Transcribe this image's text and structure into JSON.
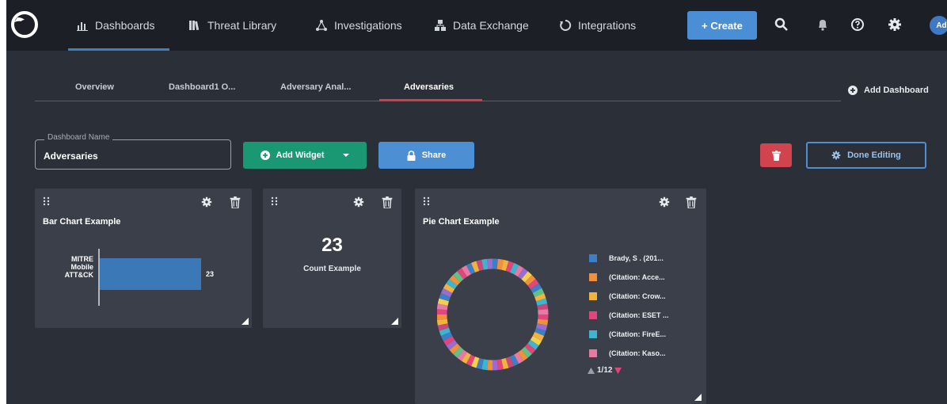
{
  "nav": {
    "items": [
      {
        "label": "Dashboards",
        "icon": "bar-chart-icon"
      },
      {
        "label": "Threat Library",
        "icon": "library-icon"
      },
      {
        "label": "Investigations",
        "icon": "network-icon"
      },
      {
        "label": "Data Exchange",
        "icon": "exchange-icon"
      },
      {
        "label": "Integrations",
        "icon": "integration-icon"
      }
    ],
    "create_label": "+ Create",
    "avatar_initials": "Ad",
    "icons": [
      "search-icon",
      "bell-icon",
      "help-icon",
      "gear-icon"
    ]
  },
  "tabs": {
    "items": [
      {
        "label": "Overview"
      },
      {
        "label": "Dashboard1 O..."
      },
      {
        "label": "Adversary Anal..."
      },
      {
        "label": "Adversaries"
      }
    ],
    "active_index": 3,
    "add_dashboard_label": "Add Dashboard"
  },
  "controls": {
    "name_label": "Dashboard Name",
    "name_value": "Adversaries",
    "add_widget_label": "Add Widget",
    "share_label": "Share",
    "done_label": "Done Editing"
  },
  "widgets": {
    "bar": {
      "title": "Bar Chart Example",
      "chart_data": {
        "type": "bar",
        "orientation": "horizontal",
        "categories": [
          "MITRE Mobile ATT&CK"
        ],
        "values": [
          23
        ],
        "data_labels": [
          "23"
        ],
        "xlim": [
          0,
          23
        ]
      }
    },
    "count": {
      "value": "23",
      "label": "Count Example"
    },
    "pie": {
      "title": "Pie Chart Example",
      "legend": [
        {
          "label": "Brady, S . (201...",
          "color": "#3d7fc6"
        },
        {
          "label": "(Citation: Acce...",
          "color": "#f0903a"
        },
        {
          "label": "(Citation: Crow...",
          "color": "#f2b33d"
        },
        {
          "label": "(Citation: ESET ...",
          "color": "#e0457c"
        },
        {
          "label": "(Citation: FireE...",
          "color": "#3cb5d0"
        },
        {
          "label": "(Citation: Kaso...",
          "color": "#e77aa3"
        }
      ],
      "pager": "1/12"
    }
  },
  "colors": {
    "accent": "#3d7fc3",
    "active_tab": "#d63a4e",
    "green": "#1a9873",
    "danger": "#d0434f"
  }
}
